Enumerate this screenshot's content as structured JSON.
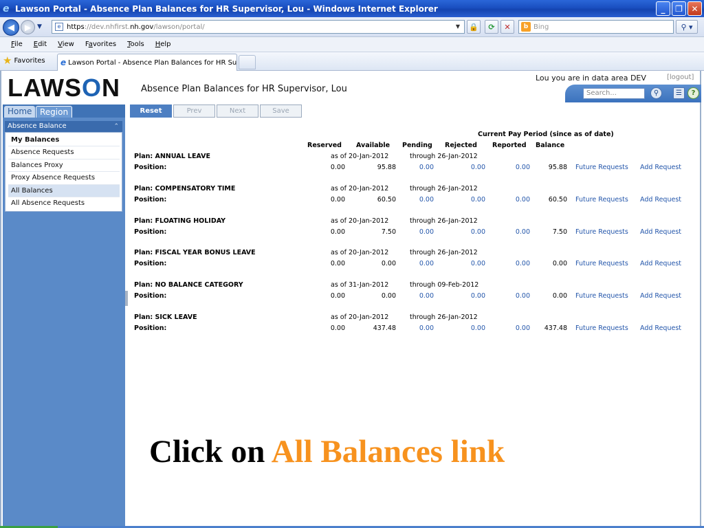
{
  "window": {
    "title": "Lawson Portal - Absence Plan Balances for HR Supervisor, Lou - Windows Internet Explorer",
    "buttons": {
      "minimize": "_",
      "maximize": "❐",
      "close": "✕"
    }
  },
  "address": {
    "url_scheme": "https",
    "url_prefix": "://dev.nhfirst.",
    "url_domain": "nh.gov",
    "url_path": "/lawson/portal/",
    "search_placeholder": "Bing"
  },
  "menu": {
    "items": [
      {
        "key": "F",
        "rest": "ile"
      },
      {
        "key": "E",
        "rest": "dit"
      },
      {
        "key": "V",
        "rest": "iew"
      },
      {
        "key": "Fa",
        "rest": "vorites",
        "underline_index": 1
      },
      {
        "key": "T",
        "rest": "ools"
      },
      {
        "key": "H",
        "rest": "elp"
      }
    ]
  },
  "favorites": {
    "label": "Favorites",
    "active_tab": "Lawson Portal - Absence Plan Balances for HR Supervi..."
  },
  "portal": {
    "logo_prefix": "LAWS",
    "logo_o": "O",
    "logo_suffix": "N",
    "page_title": "Absence Plan Balances for HR Supervisor, Lou",
    "user_info": "Lou you are in data area DEV",
    "logout": "[logout]",
    "search_placeholder": "Search...",
    "nav_tabs": {
      "home": "Home",
      "region": "Region"
    }
  },
  "sidebar": {
    "panel_title": "Absence Balance",
    "items": [
      {
        "label": "My Balances",
        "bold": true
      },
      {
        "label": "Absence Requests"
      },
      {
        "label": "Balances Proxy"
      },
      {
        "label": "Proxy Absence Requests"
      },
      {
        "label": "All Balances",
        "selected": true
      },
      {
        "label": "All Absence Requests"
      }
    ]
  },
  "toolbar": {
    "reset": "Reset",
    "prev": "Prev",
    "next": "Next",
    "save": "Save"
  },
  "table": {
    "group_header": "Current Pay Period (since as of date)",
    "columns": {
      "reserved": "Reserved",
      "available": "Available",
      "pending": "Pending",
      "rejected": "Rejected",
      "reported": "Reported",
      "balance": "Balance"
    },
    "position_label": "Position:",
    "future_requests": "Future Requests",
    "add_request": "Add Request",
    "plans": [
      {
        "plan": "Plan: ANNUAL LEAVE",
        "as_of": "as of 20-Jan-2012",
        "through": "through 26-Jan-2012",
        "reserved": "0.00",
        "available": "95.88",
        "pending": "0.00",
        "rejected": "0.00",
        "reported": "0.00",
        "balance": "95.88"
      },
      {
        "plan": "Plan: COMPENSATORY TIME",
        "as_of": "as of 20-Jan-2012",
        "through": "through 26-Jan-2012",
        "reserved": "0.00",
        "available": "60.50",
        "pending": "0.00",
        "rejected": "0.00",
        "reported": "0.00",
        "balance": "60.50"
      },
      {
        "plan": "Plan: FLOATING HOLIDAY",
        "as_of": "as of 20-Jan-2012",
        "through": "through 26-Jan-2012",
        "reserved": "0.00",
        "available": "7.50",
        "pending": "0.00",
        "rejected": "0.00",
        "reported": "0.00",
        "balance": "7.50"
      },
      {
        "plan": "Plan: FISCAL YEAR BONUS LEAVE",
        "as_of": "as of 20-Jan-2012",
        "through": "through 26-Jan-2012",
        "reserved": "0.00",
        "available": "0.00",
        "pending": "0.00",
        "rejected": "0.00",
        "reported": "0.00",
        "balance": "0.00"
      },
      {
        "plan": "Plan: NO BALANCE CATEGORY",
        "as_of": "as of 31-Jan-2012",
        "through": "through 09-Feb-2012",
        "reserved": "0.00",
        "available": "0.00",
        "pending": "0.00",
        "rejected": "0.00",
        "reported": "0.00",
        "balance": "0.00"
      },
      {
        "plan": "Plan: SICK LEAVE",
        "as_of": "as of 20-Jan-2012",
        "through": "through 26-Jan-2012",
        "reserved": "0.00",
        "available": "437.48",
        "pending": "0.00",
        "rejected": "0.00",
        "reported": "0.00",
        "balance": "437.48"
      }
    ]
  },
  "callout": {
    "prefix": "Click on ",
    "highlight": "All Balances link"
  },
  "colors": {
    "accent_orange": "#f7921e",
    "link_blue": "#2255aa",
    "sidebar_blue": "#5a8ac8"
  }
}
